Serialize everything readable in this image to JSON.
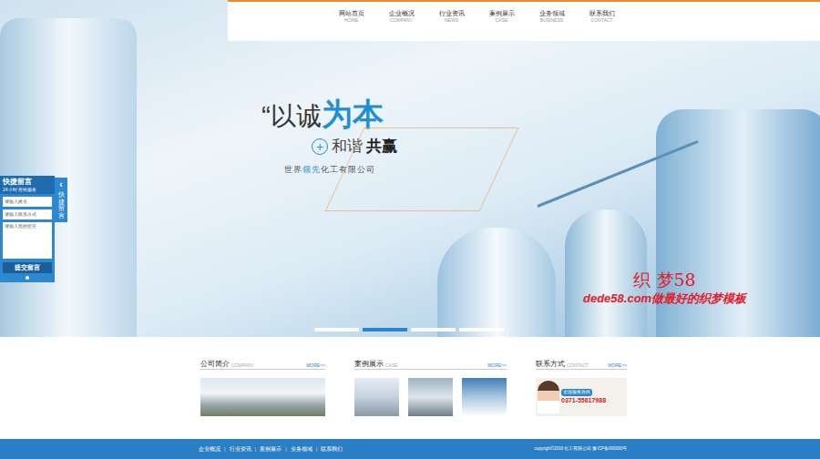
{
  "nav": [
    {
      "label": "网站首页",
      "sub": "HOME"
    },
    {
      "label": "企业概况",
      "sub": "COMPANY"
    },
    {
      "label": "行业资讯",
      "sub": "NEWS"
    },
    {
      "label": "案例展示",
      "sub": "CASE"
    },
    {
      "label": "业务领域",
      "sub": "BUSINESS"
    },
    {
      "label": "联系我们",
      "sub": "CONTACT"
    }
  ],
  "banner": {
    "quote": "“",
    "slogan_a": "以诚",
    "slogan_b": "为本",
    "plus": "+",
    "slogan2_a": "和谐",
    "slogan2_b": "共赢",
    "company_a": "世界",
    "company_b": "领先",
    "company_c": "化工有限公司"
  },
  "slides": [
    {
      "selected": false
    },
    {
      "selected": true
    },
    {
      "selected": false
    },
    {
      "selected": false
    }
  ],
  "watermark": {
    "line1": "织 梦58",
    "line2": "dede58.com做最好的织梦模板"
  },
  "quick_message": {
    "title": "快捷留言",
    "subtitle": "24小时 在线服务",
    "fields": [
      "请输入姓名",
      "请输入联系方式",
      "请输入您的留言"
    ],
    "submit": "提交留言",
    "tab": "快捷留言",
    "tab_icon": "‹"
  },
  "sections": [
    {
      "title": "公司简介",
      "sub": "COMPANY",
      "more": "MORE>>"
    },
    {
      "title": "案例展示",
      "sub": "CASE",
      "more": "MORE>>"
    },
    {
      "title": "联系方式",
      "sub": "CONTACT",
      "more": "MORE>>"
    }
  ],
  "contact": {
    "hotline": "全国服务热线",
    "phone": "0371-55617988"
  },
  "footer": {
    "links": [
      "企业概况",
      "行业资讯",
      "案例展示",
      "业务领域",
      "联系我们"
    ],
    "separator": "|",
    "copyright": "copyright©2016 化工有限公司 豫ICP备000000号"
  }
}
